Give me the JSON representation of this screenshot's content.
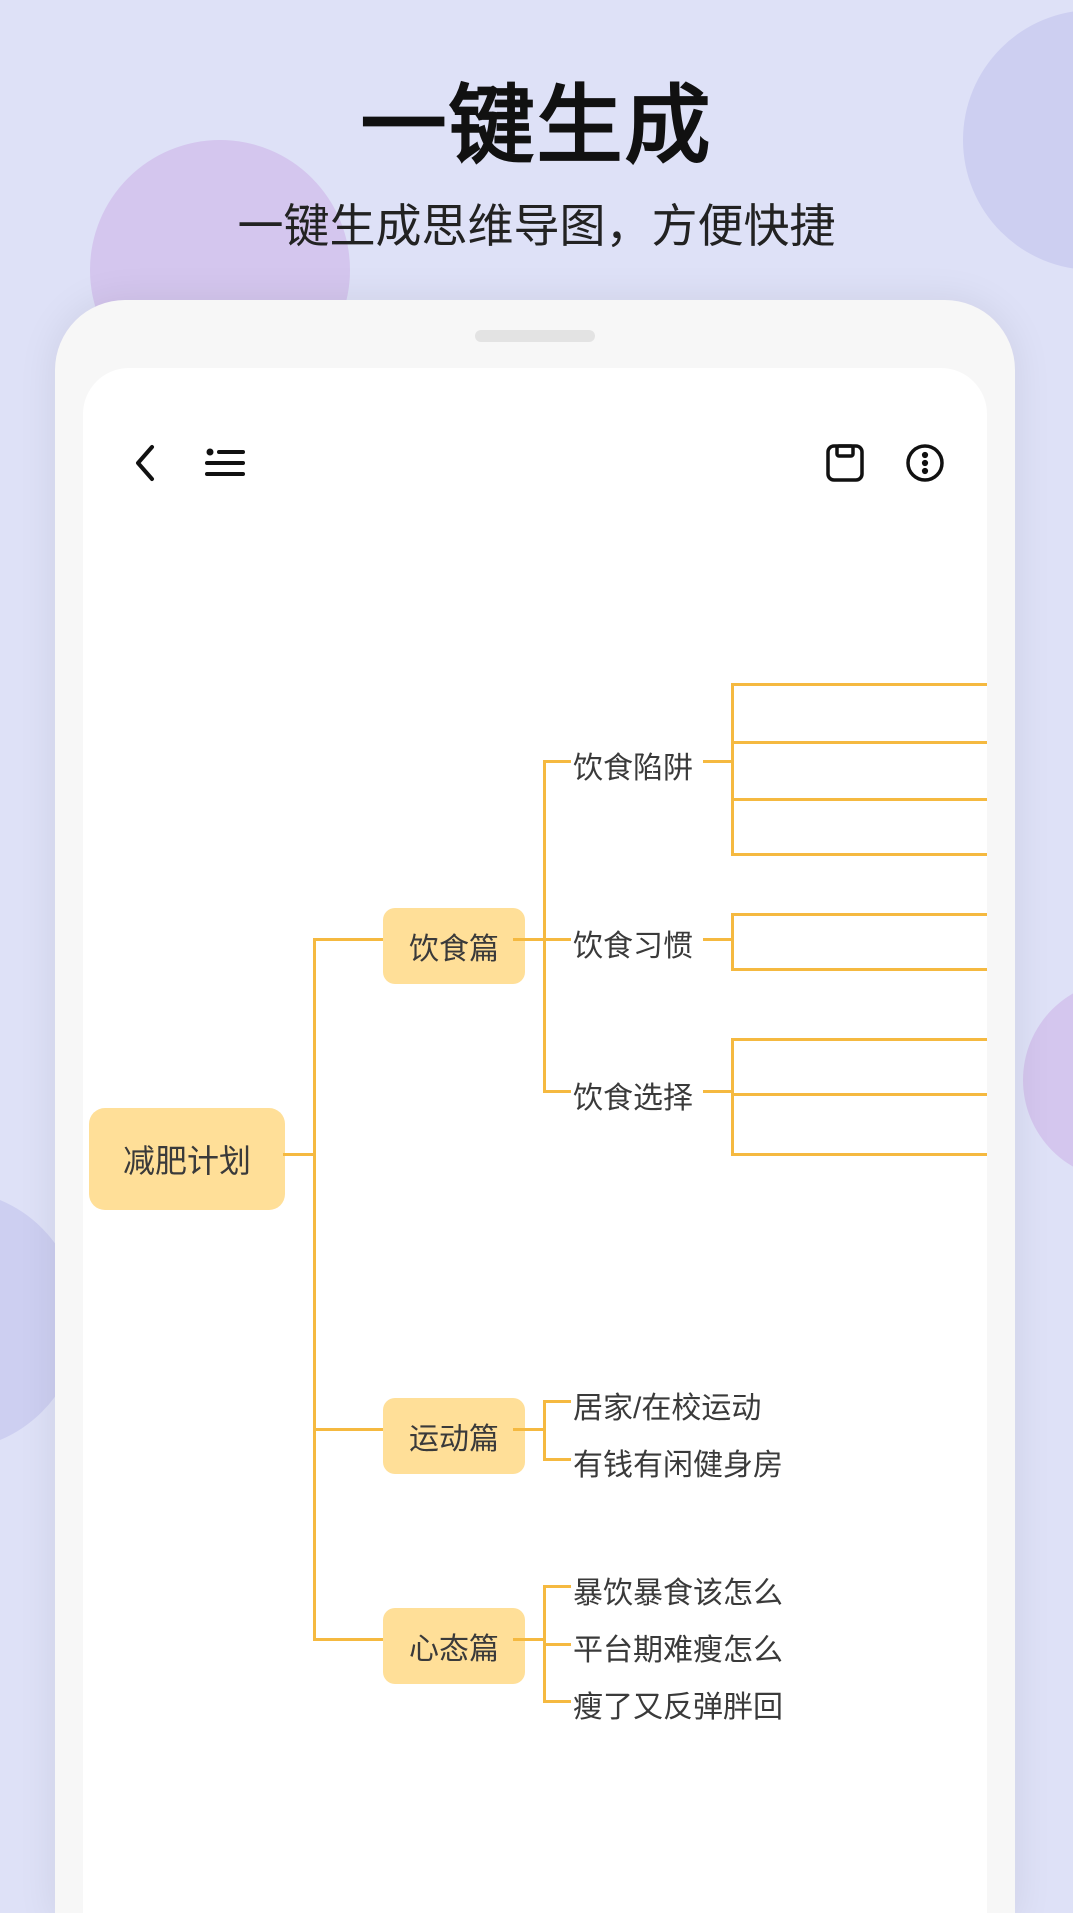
{
  "hero": {
    "title": "一键生成",
    "subtitle": "一键生成思维导图，方便快捷"
  },
  "icons": {
    "back": "back-icon",
    "list": "list-icon",
    "save": "save-icon",
    "more": "more-icon"
  },
  "mindmap": {
    "root": "减肥计划",
    "branches": [
      {
        "label": "饮食篇",
        "children": [
          "饮食陷阱",
          "饮食习惯",
          "饮食选择"
        ]
      },
      {
        "label": "运动篇",
        "children": [
          "居家/在校运动",
          "有钱有闲健身房"
        ]
      },
      {
        "label": "心态篇",
        "children": [
          "暴饮暴食该怎么",
          "平台期难瘦怎么",
          "瘦了又反弹胖回"
        ]
      }
    ]
  },
  "colors": {
    "background": "#dee1f7",
    "node": "#ffdf98",
    "line": "#f5b940"
  }
}
